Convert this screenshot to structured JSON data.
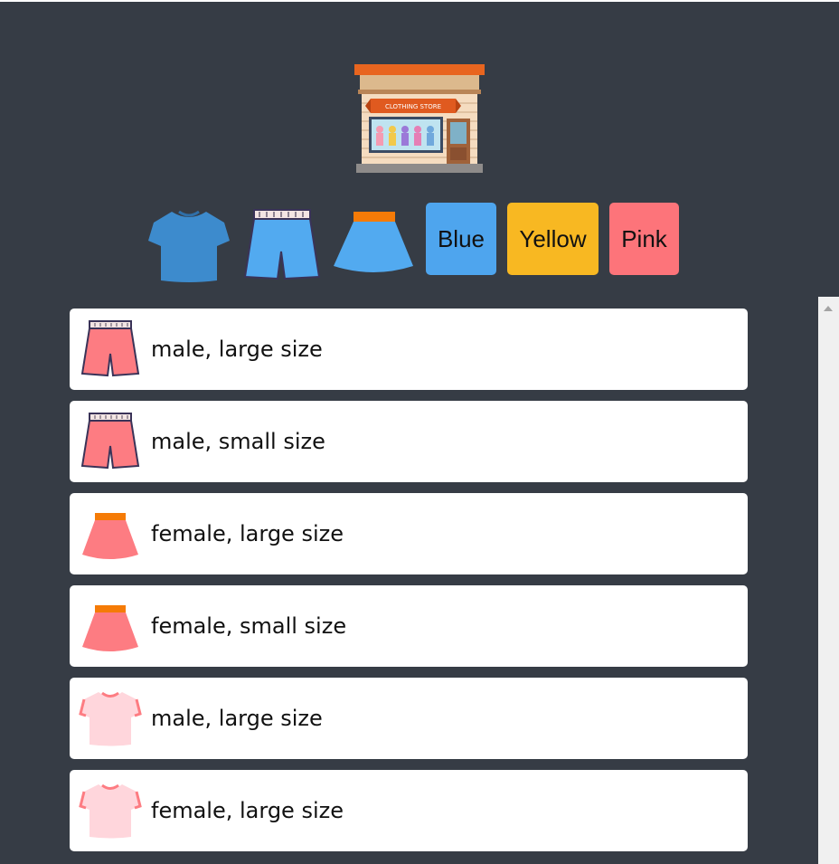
{
  "store": {
    "sign_text": "CLOTHING STORE"
  },
  "filters": {
    "icons": [
      "tshirt-icon",
      "shorts-icon",
      "skirt-icon"
    ],
    "colors": [
      {
        "label": "Blue",
        "color": "#4ea5ee"
      },
      {
        "label": "Yellow",
        "color": "#f8b822"
      },
      {
        "label": "Pink",
        "color": "#fd747a"
      }
    ]
  },
  "items": [
    {
      "icon": "shorts-icon",
      "color": "pink",
      "text": "male, large size"
    },
    {
      "icon": "shorts-icon",
      "color": "pink",
      "text": "male, small size"
    },
    {
      "icon": "skirt-icon",
      "color": "pink",
      "text": "female, large size"
    },
    {
      "icon": "skirt-icon",
      "color": "pink",
      "text": "female, small size"
    },
    {
      "icon": "tshirt-icon",
      "color": "pink",
      "text": "male, large size"
    },
    {
      "icon": "tshirt-icon",
      "color": "pink",
      "text": "female, large size"
    }
  ],
  "colors": {
    "background": "#363c45",
    "card": "#ffffff",
    "pink_item": "#fd7c82",
    "light_pink_item": "#ffd6dc",
    "blue_item": "#4ea5ee"
  }
}
